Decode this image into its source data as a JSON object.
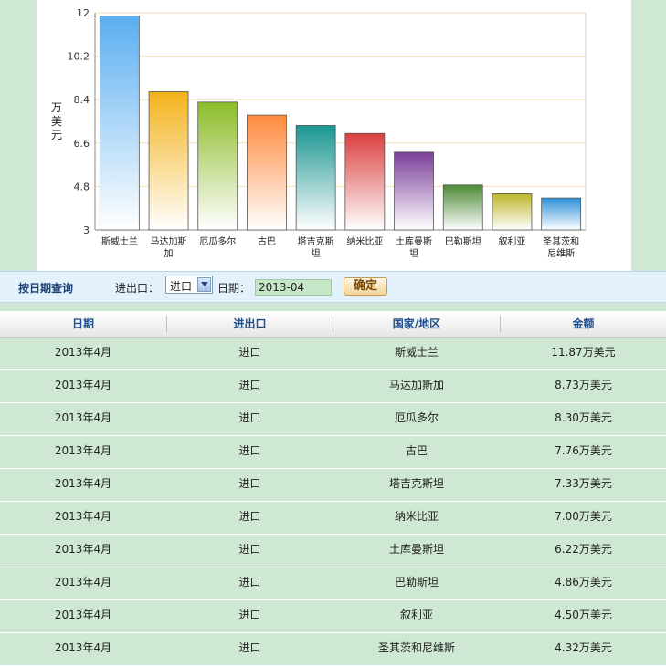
{
  "chart_data": {
    "type": "bar",
    "categories": [
      "斯威士兰",
      "马达加斯加",
      "厄瓜多尔",
      "古巴",
      "塔吉克斯坦",
      "纳米比亚",
      "土库曼斯坦",
      "巴勒斯坦",
      "叙利亚",
      "圣其茨和尼维斯"
    ],
    "category_lines": [
      [
        "斯威士兰"
      ],
      [
        "马达加斯",
        "加"
      ],
      [
        "厄瓜多尔"
      ],
      [
        "古巴"
      ],
      [
        "塔吉克斯",
        "坦"
      ],
      [
        "纳米比亚"
      ],
      [
        "土库曼斯",
        "坦"
      ],
      [
        "巴勒斯坦"
      ],
      [
        "叙利亚"
      ],
      [
        "圣其茨和",
        "尼维斯"
      ]
    ],
    "values": [
      11.87,
      8.73,
      8.3,
      7.76,
      7.33,
      7.0,
      6.22,
      4.86,
      4.5,
      4.32
    ],
    "ylabel": "万美元",
    "ylim": [
      3,
      12
    ],
    "yticks": [
      3,
      4.8,
      6.6,
      8.4,
      10.2,
      12
    ],
    "ytick_labels": [
      "3",
      "4.8",
      "6.6",
      "8.4",
      "10.2",
      "12"
    ],
    "grid": true,
    "colors": [
      "#5aaef0",
      "#f3b21a",
      "#8cbc28",
      "#ff8a3d",
      "#1a9590",
      "#db3f3f",
      "#7b3e9a",
      "#4d8a36",
      "#bdb62a",
      "#2d8fd8"
    ]
  },
  "query": {
    "title": "按日期查询",
    "type_label": "进出口：",
    "type_selected": "进口",
    "date_label": "日期：",
    "date_value": "2013-04",
    "submit_label": "确定"
  },
  "table": {
    "headers": [
      "日期",
      "进出口",
      "国家/地区",
      "金额"
    ],
    "rows": [
      [
        "2013年4月",
        "进口",
        "斯威士兰",
        "11.87万美元"
      ],
      [
        "2013年4月",
        "进口",
        "马达加斯加",
        "8.73万美元"
      ],
      [
        "2013年4月",
        "进口",
        "厄瓜多尔",
        "8.30万美元"
      ],
      [
        "2013年4月",
        "进口",
        "古巴",
        "7.76万美元"
      ],
      [
        "2013年4月",
        "进口",
        "塔吉克斯坦",
        "7.33万美元"
      ],
      [
        "2013年4月",
        "进口",
        "纳米比亚",
        "7.00万美元"
      ],
      [
        "2013年4月",
        "进口",
        "土库曼斯坦",
        "6.22万美元"
      ],
      [
        "2013年4月",
        "进口",
        "巴勒斯坦",
        "4.86万美元"
      ],
      [
        "2013年4月",
        "进口",
        "叙利亚",
        "4.50万美元"
      ],
      [
        "2013年4月",
        "进口",
        "圣其茨和尼维斯",
        "4.32万美元"
      ]
    ]
  }
}
